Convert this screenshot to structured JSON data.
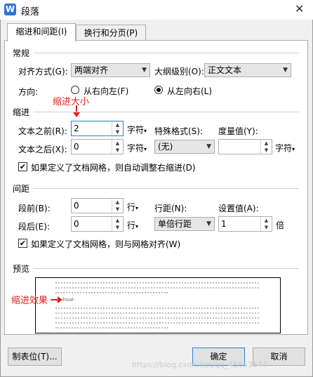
{
  "window": {
    "title": "段落",
    "app_icon": "W"
  },
  "tabs": [
    "缩进和间距(I)",
    "换行和分页(P)"
  ],
  "general": {
    "section_label": "常规",
    "alignment_label": "对齐方式(G):",
    "alignment_value": "两端对齐",
    "outline_label": "大纲级别(O):",
    "outline_value": "正文文本",
    "direction_label": "方向:",
    "rtl_label": "从右向左(F)",
    "ltr_label": "从左向右(L)"
  },
  "indent": {
    "section_label": "缩进",
    "before_label": "文本之前(R):",
    "before_value": "2",
    "after_label": "文本之后(X):",
    "after_value": "0",
    "unit": "字符",
    "special_label": "特殊格式(S):",
    "special_value": "(无)",
    "measure_label": "度量值(Y):",
    "measure_value": "",
    "grid_checkbox": "如果定义了文档网格，则自动调整右缩进(D)"
  },
  "spacing": {
    "section_label": "间距",
    "before_label": "段前(B):",
    "before_value": "0",
    "after_label": "段后(E):",
    "after_value": "0",
    "unit": "行",
    "line_label": "行距(N):",
    "line_value": "单倍行距",
    "setting_label": "设置值(A):",
    "setting_value": "1",
    "setting_unit": "倍",
    "grid_checkbox": "如果定义了文档网格，则与网格对齐(W)"
  },
  "preview": {
    "section_label": "预览",
    "sample_text": "-hoal-"
  },
  "annotations": {
    "indent_size": "缩进大小",
    "indent_effect": "缩进效果"
  },
  "buttons": {
    "tab_stops": "制表位(T)...",
    "ok": "确定",
    "cancel": "取消"
  },
  "watermark": "https://blog.csdn.net/qq_45653547",
  "colors": {
    "annotation": "#e0201c",
    "focus": "#2a7fd4"
  }
}
